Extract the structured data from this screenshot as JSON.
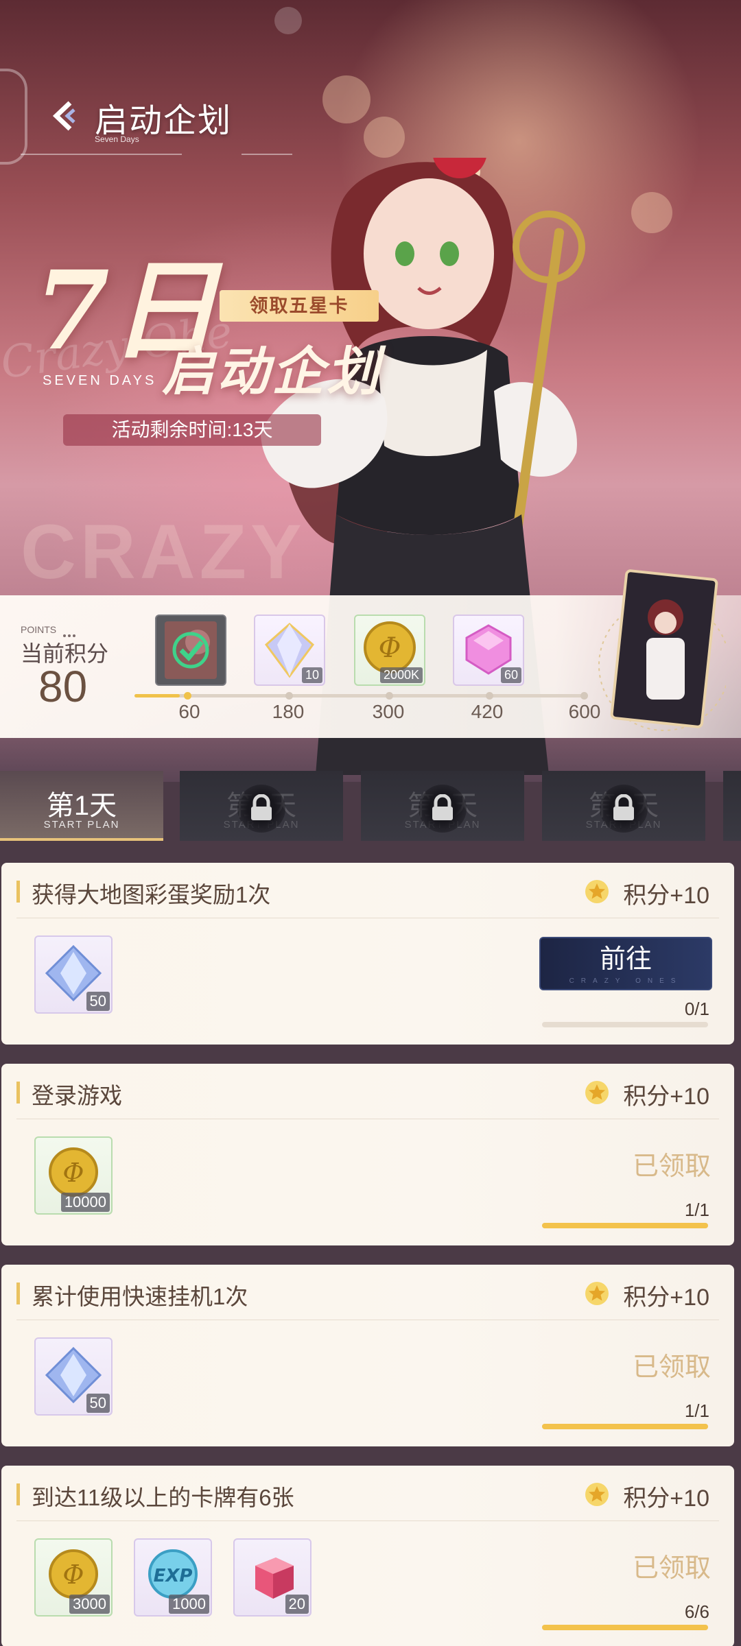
{
  "header": {
    "title": "启动企划",
    "subtitle": "Seven Days"
  },
  "banner": {
    "big_number": "7日",
    "seven_days": "SEVEN DAYS",
    "event_name": "启动企划",
    "tag": "领取五星卡",
    "remaining_time": "活动剩余时间:13天",
    "crazy_script": "Crazy Ohe",
    "crazy_big": "CRAZY ONE"
  },
  "points": {
    "label": "POINTS",
    "title": "当前积分",
    "value": "80",
    "progress_fraction": 0.1,
    "milestones": [
      {
        "points": "60",
        "reward": "card",
        "qty": "",
        "claimed": true,
        "reached": true
      },
      {
        "points": "180",
        "reward": "diamond-crystal",
        "qty": "10",
        "claimed": false,
        "reached": false
      },
      {
        "points": "300",
        "reward": "gold-coin",
        "qty": "2000K",
        "claimed": false,
        "reached": false
      },
      {
        "points": "420",
        "reward": "pink-gem",
        "qty": "60",
        "claimed": false,
        "reached": false
      },
      {
        "points": "600",
        "reward": "five-star-card",
        "qty": "",
        "claimed": false,
        "reached": false
      }
    ]
  },
  "tabs": [
    {
      "label": "第1天",
      "sub": "START   PLAN",
      "active": true,
      "locked": false
    },
    {
      "label": "第2天",
      "sub": "START PLAN",
      "active": false,
      "locked": true
    },
    {
      "label": "第3天",
      "sub": "START PLAN",
      "active": false,
      "locked": true
    },
    {
      "label": "第4天",
      "sub": "START PLAN",
      "active": false,
      "locked": true
    }
  ],
  "tasks": [
    {
      "title": "获得大地图彩蛋奖励1次",
      "points": "积分+10",
      "rewards": [
        {
          "type": "diamond",
          "qty": "50"
        }
      ],
      "action": "前往",
      "action_deco": "CRAZY ONES",
      "status": "",
      "progress": "0/1",
      "progress_fraction": 0
    },
    {
      "title": "登录游戏",
      "points": "积分+10",
      "rewards": [
        {
          "type": "gold-coin",
          "qty": "10000"
        }
      ],
      "action": "",
      "status": "已领取",
      "progress": "1/1",
      "progress_fraction": 1
    },
    {
      "title": "累计使用快速挂机1次",
      "points": "积分+10",
      "rewards": [
        {
          "type": "diamond",
          "qty": "50"
        }
      ],
      "action": "",
      "status": "已领取",
      "progress": "1/1",
      "progress_fraction": 1
    },
    {
      "title": "到达11级以上的卡牌有6张",
      "points": "积分+10",
      "rewards": [
        {
          "type": "gold-coin",
          "qty": "3000"
        },
        {
          "type": "exp-coin",
          "qty": "1000"
        },
        {
          "type": "pink-cube",
          "qty": "20"
        }
      ],
      "action": "",
      "status": "已领取",
      "progress": "6/6",
      "progress_fraction": 1
    }
  ],
  "colors": {
    "accent_gold": "#f3c24c",
    "go_button": "#1d2544",
    "claimed_text": "#d8b98a"
  }
}
